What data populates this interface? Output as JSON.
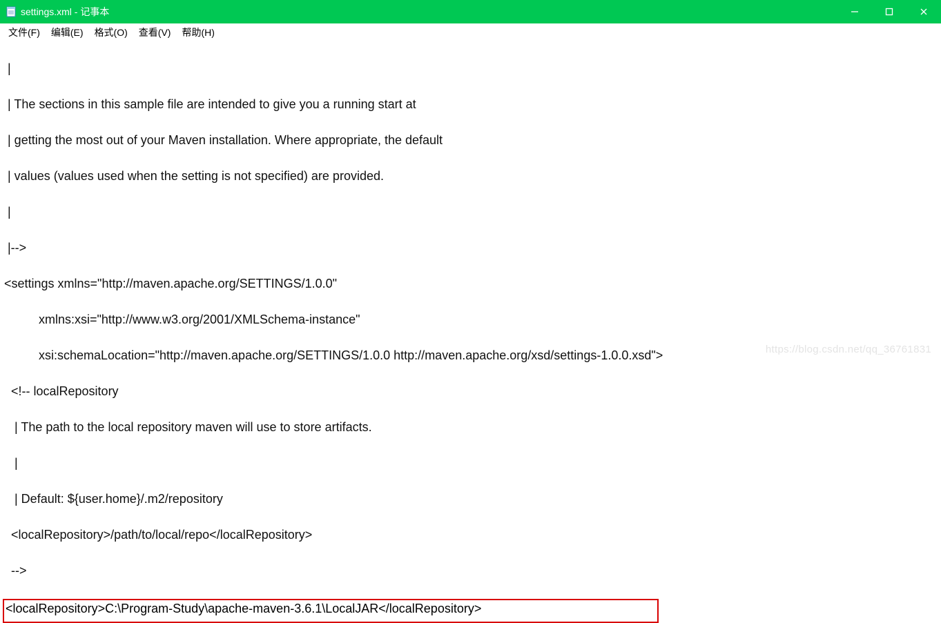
{
  "titlebar": {
    "title": "settings.xml - 记事本"
  },
  "menu": {
    "file": "文件(F)",
    "edit": "编辑(E)",
    "format": "格式(O)",
    "view": "查看(V)",
    "help": "帮助(H)"
  },
  "content": {
    "l01": " |",
    "l02": " | The sections in this sample file are intended to give you a running start at",
    "l03": " | getting the most out of your Maven installation. Where appropriate, the default",
    "l04": " | values (values used when the setting is not specified) are provided.",
    "l05": " |",
    "l06": " |-->",
    "l07": "<settings xmlns=\"http://maven.apache.org/SETTINGS/1.0.0\"",
    "l08": "          xmlns:xsi=\"http://www.w3.org/2001/XMLSchema-instance\"",
    "l09": "          xsi:schemaLocation=\"http://maven.apache.org/SETTINGS/1.0.0 http://maven.apache.org/xsd/settings-1.0.0.xsd\">",
    "l10": "  <!-- localRepository",
    "l11": "   | The path to the local repository maven will use to store artifacts.",
    "l12": "   |",
    "l13": "   | Default: ${user.home}/.m2/repository",
    "l14": "  <localRepository>/path/to/local/repo</localRepository>",
    "l15": "  -->",
    "boxed": "<localRepository>C:\\Program-Study\\apache-maven-3.6.1\\LocalJAR</localRepository>"
  },
  "watermark": "https://blog.csdn.net/qq_36761831"
}
